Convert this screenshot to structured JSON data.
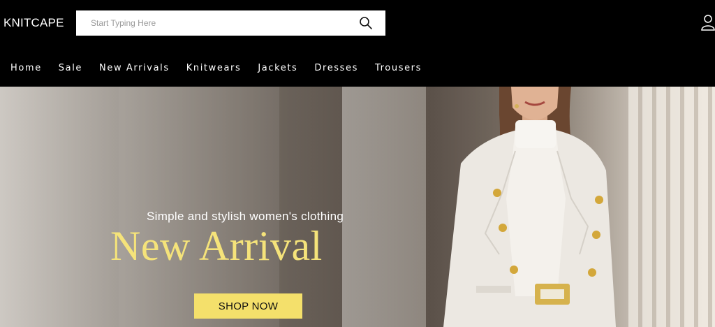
{
  "brand": {
    "name": "KNITCAPE"
  },
  "search": {
    "placeholder": "Start Typing Here",
    "value": ""
  },
  "nav": {
    "items": [
      "Home",
      "Sale",
      "New Arrivals",
      "Knitwears",
      "Jackets",
      "Dresses",
      "Trousers"
    ]
  },
  "hero": {
    "tagline": "Simple and stylish women's clothing",
    "headline": "New Arrival",
    "cta_label": "SHOP NOW"
  },
  "colors": {
    "header_bg": "#000000",
    "headline": "#f5e37a",
    "cta_bg": "#f4e06b"
  },
  "icons": [
    "search-icon",
    "user-icon"
  ]
}
